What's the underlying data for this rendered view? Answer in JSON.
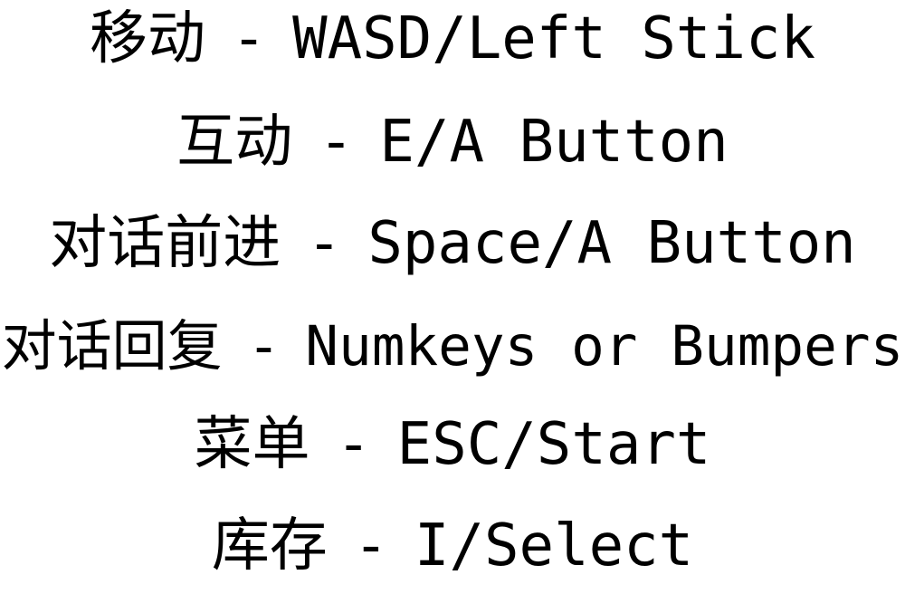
{
  "controls": [
    {
      "action": "移动",
      "sep": "-",
      "keys": "WASD/Left Stick"
    },
    {
      "action": "互动",
      "sep": "-",
      "keys": "E/A Button"
    },
    {
      "action": "对话前进",
      "sep": "-",
      "keys": "Space/A Button"
    },
    {
      "action": "对话回复",
      "sep": "-",
      "keys": "Numkeys or Bumpers"
    },
    {
      "action": "菜单",
      "sep": "-",
      "keys": "ESC/Start"
    },
    {
      "action": "库存",
      "sep": "-",
      "keys": "I/Select"
    }
  ],
  "colors": {
    "text": "#000000",
    "background": "#ffffff"
  }
}
